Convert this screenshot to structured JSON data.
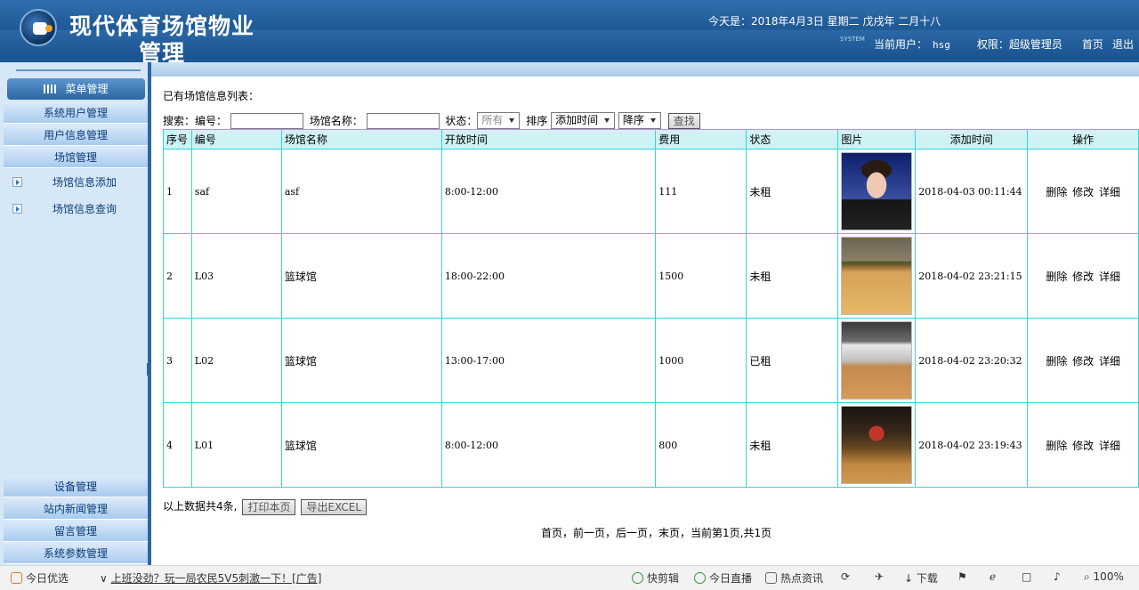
{
  "header": {
    "title_line1": "现代体育场馆物业",
    "title_line2": "管理",
    "date": "今天是：2018年4月3日 星期二 戊戌年 二月十八",
    "system_tag": "SYSTEM",
    "current_user_label": "当前用户：",
    "current_user": "hsg",
    "role_label": "权限：",
    "role": "超级管理员",
    "home_link": "首页",
    "logout_link": "退出"
  },
  "sidebar": {
    "menu_title": "菜单管理",
    "items_top": [
      "系统用户管理",
      "用户信息管理",
      "场馆管理"
    ],
    "sub_items": [
      "场馆信息添加",
      "场馆信息查询"
    ],
    "items_bottom": [
      "设备管理",
      "站内新闻管理",
      "留言管理",
      "系统参数管理"
    ]
  },
  "main": {
    "list_title": "已有场馆信息列表：",
    "search": {
      "label": "搜索：",
      "code_label": "编号：",
      "name_label": "场馆名称：",
      "status_label": "状态：",
      "status_value": "所有",
      "sort_label": "排序",
      "sort_field": "添加时间",
      "sort_order": "降序",
      "search_button": "查找",
      "code_value": "",
      "name_value": ""
    },
    "table": {
      "columns": [
        "序号",
        "编号",
        "场馆名称",
        "开放时间",
        "费用",
        "状态",
        "图片",
        "添加时间",
        "操作"
      ],
      "rows": [
        {
          "index": "1",
          "code": "saf",
          "name": "asf",
          "hours": "8:00-12:00",
          "fee": "111",
          "status": "未租",
          "image": "portrait-photo",
          "added": "2018-04-03 00:11:44"
        },
        {
          "index": "2",
          "code": "L03",
          "name": "篮球馆",
          "hours": "18:00-22:00",
          "fee": "1500",
          "status": "未租",
          "image": "gym-photo",
          "added": "2018-04-02 23:21:15"
        },
        {
          "index": "3",
          "code": "L02",
          "name": "篮球馆",
          "hours": "13:00-17:00",
          "fee": "1000",
          "status": "已租",
          "image": "gym-photo",
          "added": "2018-04-02 23:20:32"
        },
        {
          "index": "4",
          "code": "L01",
          "name": "篮球馆",
          "hours": "8:00-12:00",
          "fee": "800",
          "status": "未租",
          "image": "gym-photo",
          "added": "2018-04-02 23:19:43"
        }
      ],
      "op_delete": "删除",
      "op_edit": "修改",
      "op_detail": "详细"
    },
    "summary": "以上数据共4条,",
    "print_button": "打印本页",
    "export_button": "导出EXCEL",
    "pager": "首页，前一页，后一页，末页，当前第1页,共1页"
  },
  "statusbar": {
    "today_pick": "今日优选",
    "news": "上班没劲？玩一局农民5V5刺激一下！[广告]",
    "quick_clip": "快剪辑",
    "live": "今日直播",
    "hot_news": "热点资讯",
    "download": "下载",
    "zoom": "100%"
  }
}
